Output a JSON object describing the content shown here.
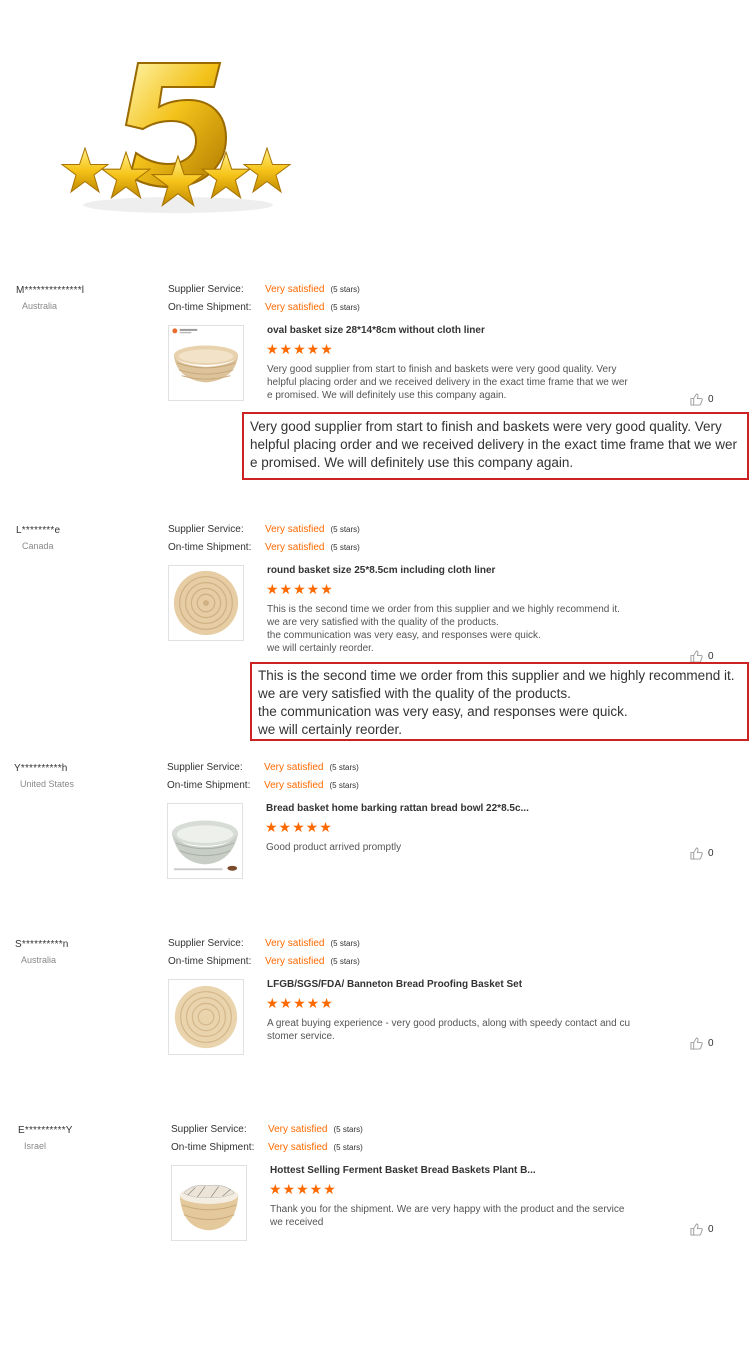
{
  "rating_label_supplier": "Supplier Service:",
  "rating_label_shipment": "On-time Shipment:",
  "colors": {
    "accent": "#ff6a00",
    "highlight_border": "#cc2222"
  },
  "reviews": [
    {
      "name": "M**************l",
      "country": "Australia",
      "supplier_rating": "Very satisfied",
      "supplier_stars": "(5 stars)",
      "shipment_rating": "Very satisfied",
      "shipment_stars": "(5 stars)",
      "product_title": "oval basket size 28*14*8cm without cloth liner",
      "stars": "★★★★★",
      "text": [
        "Very good supplier from start to finish and baskets were very good quality.   Very",
        "helpful placing order and we received delivery in the exact time frame that we wer",
        "e promised.    We will definitely use this company again."
      ],
      "helpful_count": "0",
      "highlight": [
        "Very good supplier from start to finish and baskets were very good quality.   Very",
        "helpful placing order and we received delivery in the exact time frame that we wer",
        "e promised.    We will definitely use this company again."
      ]
    },
    {
      "name": "L********e",
      "country": "Canada",
      "supplier_rating": "Very satisfied",
      "supplier_stars": "(5 stars)",
      "shipment_rating": "Very satisfied",
      "shipment_stars": "(5 stars)",
      "product_title": "round basket size 25*8.5cm including cloth liner",
      "stars": "★★★★★",
      "text": [
        "This is the second time we order from this supplier and we highly recommend it.",
        "we are very satisfied with the quality of the products.",
        "the communication was very easy, and responses were quick.",
        "we will certainly reorder."
      ],
      "helpful_count": "0",
      "highlight": [
        "This is the second time we order from this supplier and we highly recommend it.",
        "we are very satisfied with the quality of the products.",
        "the communication was very easy, and responses were quick.",
        "we will certainly reorder."
      ]
    },
    {
      "name": "Y**********h",
      "country": "United States",
      "supplier_rating": "Very satisfied",
      "supplier_stars": "(5 stars)",
      "shipment_rating": "Very satisfied",
      "shipment_stars": "(5 stars)",
      "product_title": "Bread basket home barking rattan bread bowl 22*8.5c...",
      "stars": "★★★★★",
      "text": [
        "Good product arrived promptly"
      ],
      "helpful_count": "0"
    },
    {
      "name": "S**********n",
      "country": "Australia",
      "supplier_rating": "Very satisfied",
      "supplier_stars": "(5 stars)",
      "shipment_rating": "Very satisfied",
      "shipment_stars": "(5 stars)",
      "product_title": "LFGB/SGS/FDA/ Banneton Bread Proofing Basket Set",
      "stars": "★★★★★",
      "text": [
        "A great buying experience - very good products, along with speedy contact and cu",
        "stomer service."
      ],
      "helpful_count": "0"
    },
    {
      "name": "E**********Y",
      "country": "Israel",
      "supplier_rating": "Very satisfied",
      "supplier_stars": "(5 stars)",
      "shipment_rating": "Very satisfied",
      "shipment_stars": "(5 stars)",
      "product_title": "Hottest Selling Ferment Basket Bread Baskets Plant B...",
      "stars": "★★★★★",
      "text": [
        "Thank you for the shipment.  We are very happy with the product and the service",
        "we received"
      ],
      "helpful_count": "0"
    }
  ]
}
